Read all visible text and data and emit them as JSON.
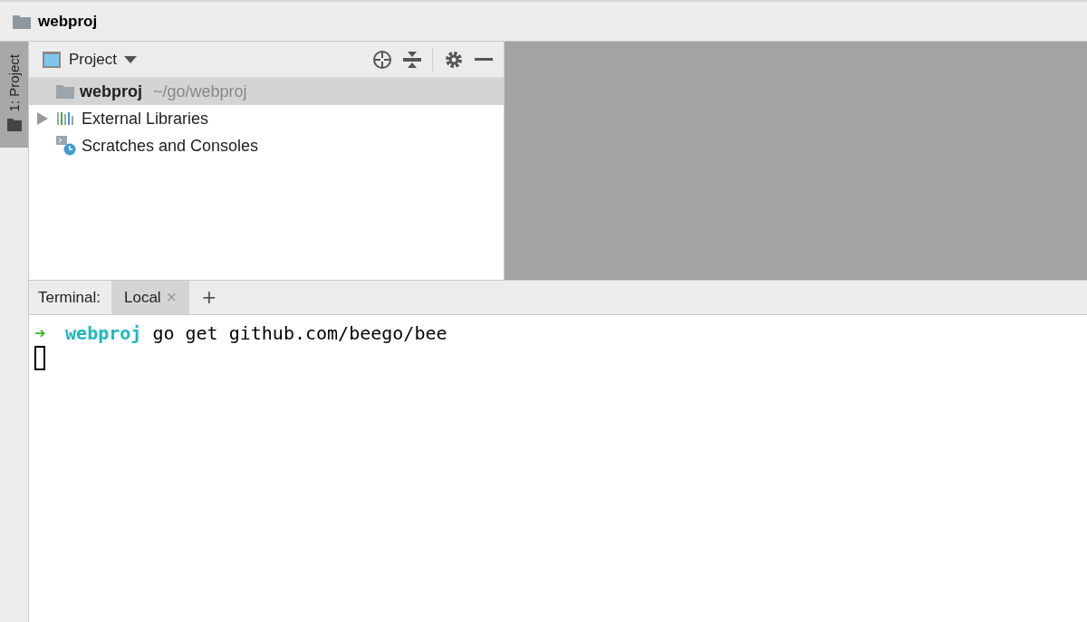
{
  "window": {
    "title": "webproj"
  },
  "tool_stripe": [
    {
      "label": "1: Project",
      "selected": true
    }
  ],
  "project_panel": {
    "view": "Project",
    "tree": [
      {
        "kind": "folder",
        "name": "webproj",
        "path": "~/go/webproj",
        "selected": true,
        "arrow": false
      },
      {
        "kind": "libraries",
        "name": "External Libraries",
        "selected": false,
        "arrow": true
      },
      {
        "kind": "scratches",
        "name": "Scratches and Consoles",
        "selected": false,
        "arrow": false
      }
    ]
  },
  "terminal": {
    "label": "Terminal:",
    "tabs": [
      {
        "label": "Local",
        "close": "×",
        "selected": true
      }
    ],
    "add": "+",
    "lines": [
      {
        "prompt": "➜",
        "dir": "webproj",
        "command": "go get github.com/beego/bee"
      }
    ],
    "cursor": true
  }
}
